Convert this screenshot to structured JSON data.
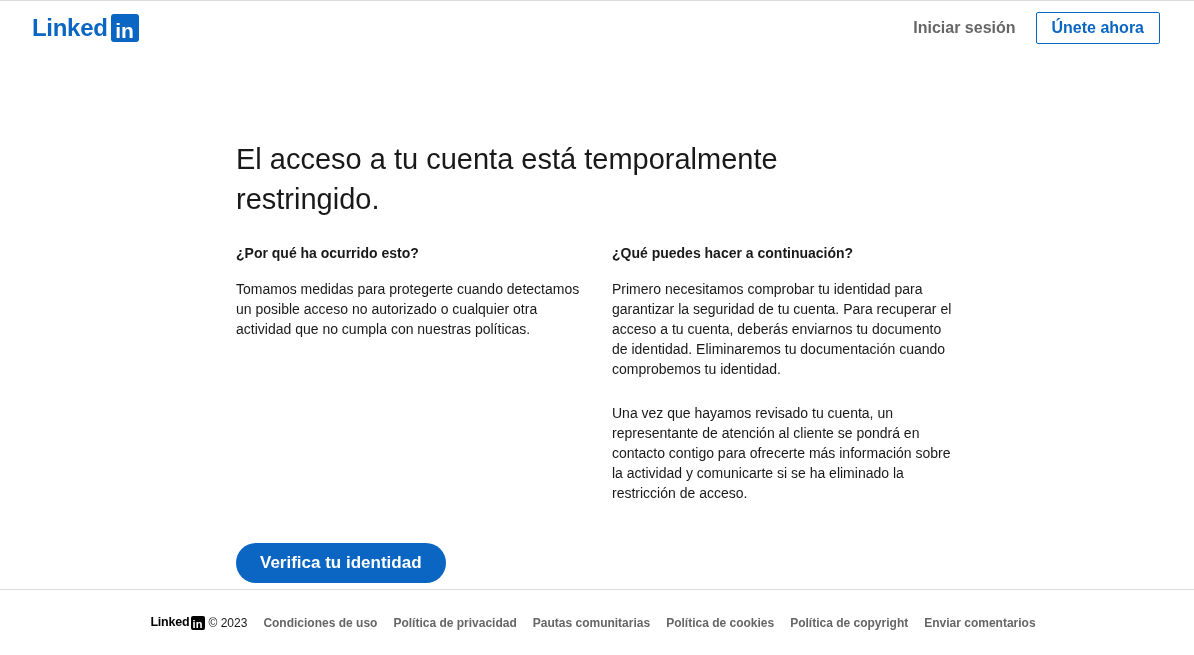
{
  "header": {
    "logo": {
      "text": "Linked",
      "badge": "in"
    },
    "sign_in_link": "Iniciar sesión",
    "join_button": "Únete ahora"
  },
  "main": {
    "title": "El acceso a tu cuenta está temporalmente restringido.",
    "sections": [
      {
        "heading": "¿Por qué ha ocurrido esto?",
        "paragraphs": [
          "Tomamos medidas para protegerte cuando detectamos un posible acceso no autorizado o cualquier otra actividad que no cumpla con nuestras políticas."
        ]
      },
      {
        "heading": "¿Qué puedes hacer a continuación?",
        "paragraphs": [
          "Primero necesitamos comprobar tu identidad para garantizar la seguridad de tu cuenta. Para recuperar el acceso a tu cuenta, deberás enviarnos tu documento de identidad. Eliminaremos tu documentación cuando comprobemos tu identidad.",
          "Una vez que hayamos revisado tu cuenta, un representante de atención al cliente se pondrá en contacto contigo para ofrecerte más información sobre la actividad y comunicarte si se ha eliminado la restricción de acceso."
        ]
      }
    ],
    "button": "Verifica tu identidad"
  },
  "footer": {
    "logo": {
      "text": "Linked",
      "badge": "in"
    },
    "copyright": "© 2023",
    "links": [
      "Condiciones de uso",
      "Política de privacidad",
      "Pautas comunitarias",
      "Política de cookies",
      "Política de copyright",
      "Enviar comentarios"
    ]
  }
}
